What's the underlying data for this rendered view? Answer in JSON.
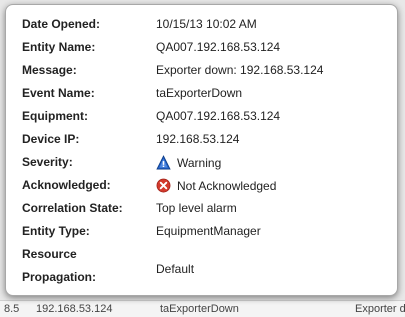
{
  "details": {
    "rows": [
      {
        "label": "Date Opened:",
        "value": "10/15/13 10:02 AM"
      },
      {
        "label": "Entity Name:",
        "value": "QA007.192.168.53.124"
      },
      {
        "label": "Message:",
        "value": "Exporter down: 192.168.53.124"
      },
      {
        "label": "Event Name:",
        "value": "taExporterDown"
      },
      {
        "label": "Equipment:",
        "value": "QA007.192.168.53.124"
      },
      {
        "label": "Device IP:",
        "value": "192.168.53.124"
      },
      {
        "label": "Severity:",
        "value": "Warning",
        "icon": "warning-triangle-icon"
      },
      {
        "label": "Acknowledged:",
        "value": "Not Acknowledged",
        "icon": "red-x-circle-icon"
      },
      {
        "label": "Correlation State:",
        "value": "Top level alarm"
      },
      {
        "label": "Entity Type:",
        "value": "EquipmentManager"
      }
    ],
    "resource_propagation": {
      "label_line1": "Resource",
      "label_line2": "Propagation:",
      "value": "Default"
    }
  },
  "background_row": {
    "col1": "8.5",
    "col2": "192.168.53.124",
    "col3": "taExporterDown",
    "col4": "Exporter do"
  },
  "colors": {
    "warning_icon": "#1e5bbf",
    "ack_icon": "#d33a2c"
  }
}
